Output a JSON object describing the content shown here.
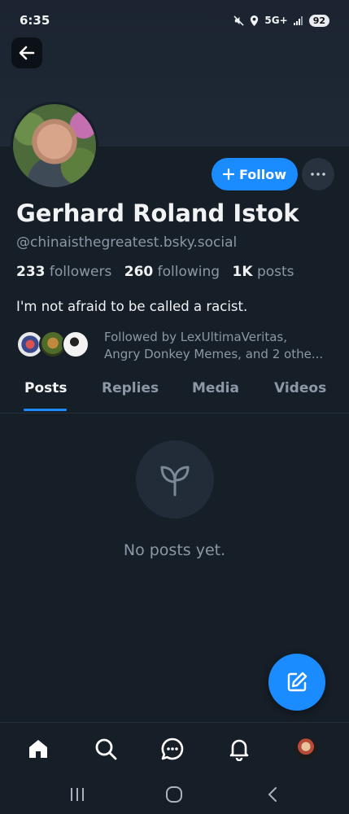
{
  "status_bar": {
    "time": "6:35",
    "network": "5G+",
    "battery": "92"
  },
  "profile": {
    "display_name": "Gerhard Roland Istok",
    "handle": "@chinaisthegreatest.bsky.social",
    "followers_count": "233",
    "followers_label": "followers",
    "following_count": "260",
    "following_label": "following",
    "posts_count": "1K",
    "posts_label": "posts",
    "bio": "I'm not afraid to be called a racist.",
    "follow_label": "Follow",
    "followed_by_line1": "Followed by LexUltimaVeritas,",
    "followed_by_line2": "Angry Donkey Memes, and 2 othe..."
  },
  "tabs": [
    {
      "label": "Posts",
      "active": true
    },
    {
      "label": "Replies",
      "active": false
    },
    {
      "label": "Media",
      "active": false
    },
    {
      "label": "Videos",
      "active": false
    }
  ],
  "empty_state": {
    "message": "No posts yet.",
    "icon": "sprout-icon"
  },
  "bottom_nav": {
    "items": [
      "home-icon",
      "search-icon",
      "chat-icon",
      "bell-icon",
      "profile-avatar"
    ]
  },
  "colors": {
    "background": "#161e27",
    "accent": "#1a8cff",
    "muted_text": "#8c98a6",
    "primary_text": "#f1f3f5"
  }
}
